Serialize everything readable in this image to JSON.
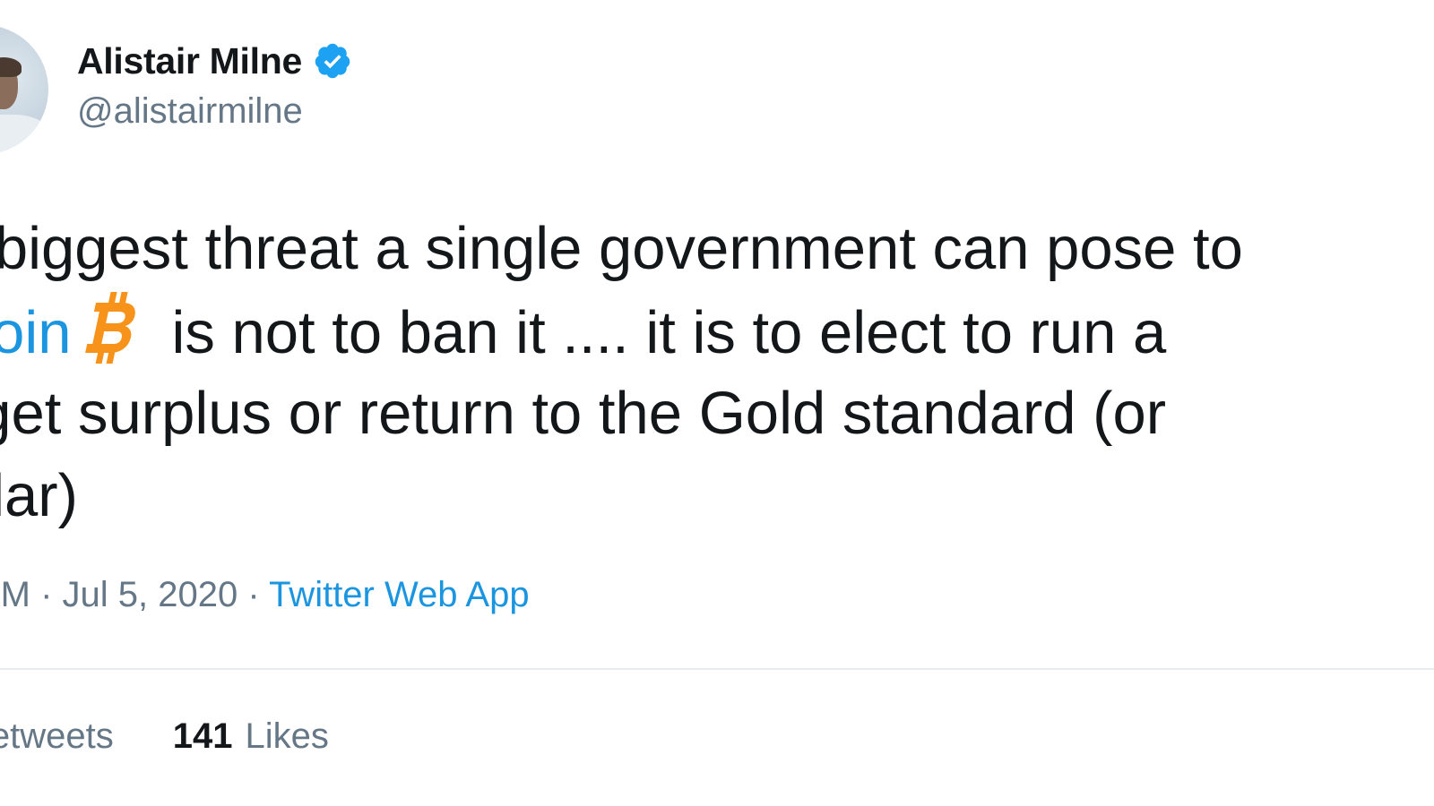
{
  "author": {
    "display_name": "Alistair Milne",
    "handle": "@alistairmilne",
    "verified": true,
    "verified_icon": "verified-badge-icon",
    "verified_color": "#1da1f2"
  },
  "tweet": {
    "line1": "e biggest threat a single government can pose to",
    "line2_hashtag": "tcoin",
    "line2_icon": "bitcoin-icon",
    "line2_rest": "is not to ban it .... it is to elect to run a",
    "line3": "dget surplus or return to the Gold standard (or",
    "line4": "nilar)"
  },
  "meta": {
    "time": "PM",
    "sep1": " · ",
    "date": "Jul 5, 2020",
    "sep2": " · ",
    "source": "Twitter Web App"
  },
  "stats": {
    "retweets_label": "Retweets",
    "likes_count": "141",
    "likes_label": "Likes"
  },
  "colors": {
    "link": "#1b95e0",
    "secondary_text": "#657786",
    "primary_text": "#14171a",
    "bitcoin_orange": "#f7931a",
    "divider": "#e6ecf0"
  }
}
